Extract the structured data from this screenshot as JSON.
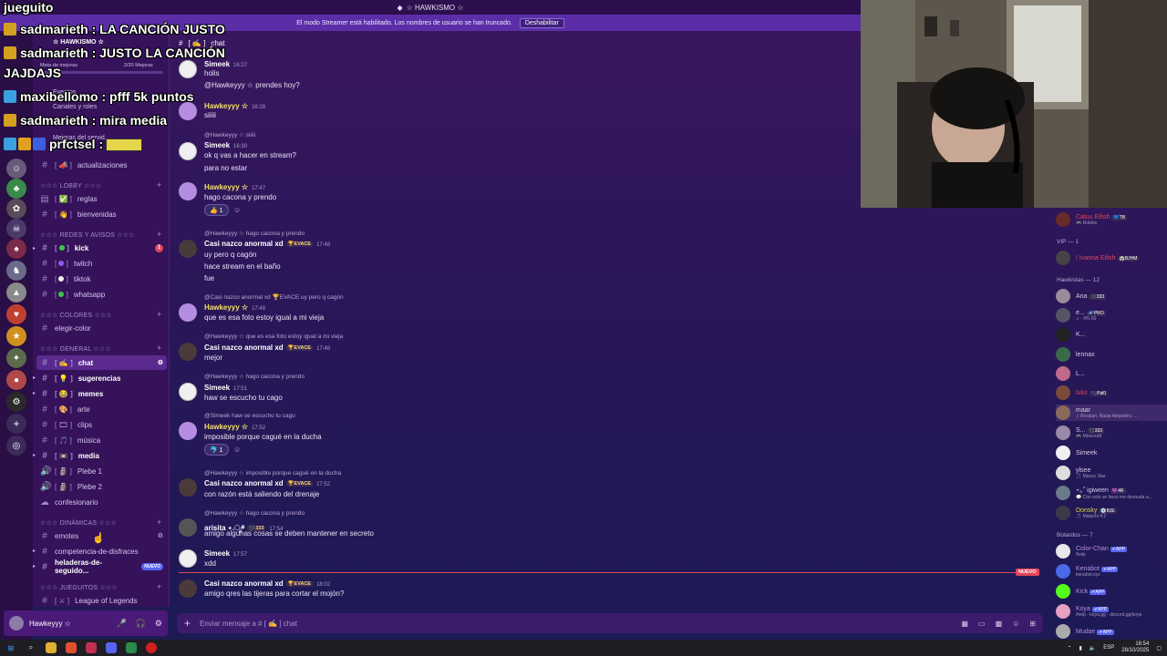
{
  "server": {
    "name": "☆ HAWKISMO ☆",
    "streamer_notice": "El modo Streamer está habilitado. Los nombres de usuario se han truncado.",
    "disable_button": "Deshabilitar",
    "boost_label": "Meta de mejoras",
    "boost_count": "2/20 Mejoras",
    "events": "Eventos",
    "channels_roles": "Canales y roles",
    "server_boosts": "Mejoras del servid..."
  },
  "sidebar": {
    "categories": {
      "lobby": "☆☆☆ LOBBY ☆☆☆",
      "redes": "☆☆☆ REDES Y AVISOS ☆☆☆",
      "colores": "☆☆☆ COLORES ☆☆☆",
      "general": "☆☆☆ GENERAL ☆☆☆",
      "dinamicas": "☆☆☆ DINÁMICAS ☆☆☆",
      "juegos": "☆☆☆ JUEGUITOS ☆☆☆"
    },
    "channels": {
      "actualizaciones": "actualizaciones",
      "reglas": "reglas",
      "bienvenidas": "bienvenidas",
      "kick": "kick",
      "twitch": "twitch",
      "tiktok": "tiktok",
      "whatsapp": "whatsapp",
      "elegir_color": "elegir-color",
      "chat": "chat",
      "sugerencias": "sugerencias",
      "memes": "memes",
      "arte": "arte",
      "clips": "clips",
      "musica": "música",
      "media": "media",
      "plebe1": "Plebe 1",
      "plebe2": "Plebe 2",
      "confesionario": "confesionario",
      "emotes": "emotes",
      "competencia": "competencia-de-disfraces",
      "heladeras": "heladeras-de-seguido...",
      "league": "League of Legends"
    },
    "nuevo_badge": "NUEVO",
    "kick_badge": "1"
  },
  "user_panel": {
    "name": "Hawkeyyy ☆",
    "status": "⋯"
  },
  "chat": {
    "header": "chat",
    "composer_placeholder": "Enviar mensaje a # [ ✍ ] chat",
    "new_label": "NUEVO",
    "messages": [
      {
        "author": "Simeek",
        "time": "16:27",
        "lines": [
          "holis",
          "@Hawkeyyy ☆ prendes hoy?"
        ]
      },
      {
        "author": "Hawkeyyy ☆",
        "time": "16:28",
        "lines": [
          "siiiii"
        ]
      },
      {
        "reply": "@Hawkeyyy ☆ siiiii",
        "author": "Simeek",
        "time": "16:30",
        "lines": [
          "ok q vas a hacer en stream?",
          "para no estar"
        ]
      },
      {
        "author": "Hawkeyyy ☆",
        "time": "17:47",
        "lines": [
          "hago cacona y prendo"
        ],
        "reaction": "👍 1"
      },
      {
        "reply": "@Hawkeyyy ☆ hago cacona y prendo",
        "author": "Casi nazco anormal xd",
        "badge": "🏆EVACE",
        "time": "17:48",
        "lines": [
          "uy pero q cagón",
          "hace stream en el baño",
          "fue"
        ]
      },
      {
        "reply": "@Casi nazco anormal xd 🏆EVACE uy pero q cagón",
        "author": "Hawkeyyy ☆",
        "time": "17:48",
        "lines": [
          "que es esa foto estoy igual a mi vieja"
        ]
      },
      {
        "reply": "@Hawkeyyy ☆ que es esa foto estoy igual a mi vieja",
        "author": "Casi nazco anormal xd",
        "badge": "🏆EVACE",
        "time": "17:48",
        "lines": [
          "mejor"
        ]
      },
      {
        "reply": "@Hawkeyyy ☆ hago cacona y prendo",
        "author": "Simeek",
        "time": "17:51",
        "lines": [
          "haw se escucho tu cago"
        ]
      },
      {
        "reply": "@Simeek haw se escucho tu cago",
        "author": "Hawkeyyy ☆",
        "time": "17:52",
        "lines": [
          "imposible porque cagué en la ducha"
        ],
        "reaction": "🐬 1"
      },
      {
        "reply": "@Hawkeyyy ☆ imposible porque cagué en la ducha",
        "author": "Casi nazco anormal xd",
        "badge": "🏆EVACE",
        "time": "17:52",
        "lines": [
          "con razón está saliendo del drenaje"
        ]
      },
      {
        "reply": "@Hawkeyyy ☆ hago cacona y prendo",
        "author": "arisita ⋆.ೃ࿔",
        "badge": "💱333",
        "time": "17:54",
        "lines": [
          "amigo algunas cosas se deben mantener en secreto"
        ]
      },
      {
        "author": "Simeek",
        "time": "17:57",
        "lines": [
          "xdd"
        ]
      },
      {
        "author": "Casi nazco anormal xd",
        "badge": "🏆EVACE",
        "time": "18:02",
        "lines": [
          "amigo qres las tijeras para cortar el mojón?"
        ]
      }
    ]
  },
  "members": {
    "top": {
      "name": "Catuu Eilish",
      "sub": "🎮 Roblox",
      "badge": "💙TB"
    },
    "vip_header": "VIP — 1",
    "vip": {
      "name": "! Ivanna Eilish",
      "badge": "🐼BJHM"
    },
    "hawkistas_header": "Hawkistas — 12",
    "hawkistas": [
      {
        "name": "Ana",
        "badge": "💱333"
      },
      {
        "name": "e...",
        "badge": "🌌PRO",
        "sub": "♫ · 9% 00"
      },
      {
        "name": "K..."
      },
      {
        "name": "lennax"
      },
      {
        "name": "L..."
      },
      {
        "name": "lulu!",
        "badge": "🐾Pal0"
      },
      {
        "name": "maar",
        "sub": "♫ Rvssian, Rauw Alejandro, ..."
      },
      {
        "name": "S...",
        "badge": "💱333",
        "sub": "🎮 Minecraft"
      },
      {
        "name": "Simeek"
      },
      {
        "name": "ylsee",
        "sub": "🎵 Mazzy Star"
      },
      {
        "name": "⋆｡˚ igiween",
        "badge": "💜4R",
        "sub": "💬 Con solo un beso me desnuda a..."
      },
      {
        "name": "Donsky",
        "badge": "💿BJE",
        "sub": "🎵 Malachi 4:2"
      }
    ],
    "bots_header": "Botardos — 7",
    "bots": [
      {
        "name": "Color-Chan",
        "sub": "/help"
      },
      {
        "name": "Kenabot",
        "sub": "kenabot.xyz"
      },
      {
        "name": "Kick"
      },
      {
        "name": "Koya",
        "sub": "/help - koya.gg - discord.gg/koya"
      },
      {
        "name": "Mudae"
      }
    ],
    "app_badge": "✔APP"
  },
  "overlay": {
    "top": "jueguito",
    "lines": [
      "sadmarieth : LA CANCIÓN JUSTO",
      "sadmarieth : JUSTO LA CANCIÓN",
      "JAJDAJS",
      "maxibellomo : pfff 5k puntos",
      "sadmarieth : mira media",
      "prfctsel :"
    ]
  },
  "taskbar": {
    "lang": "ESP",
    "time": "18:54",
    "date": "28/10/2025"
  },
  "colors": {
    "name_simeek": "#ffffff",
    "name_hawk": "#f2e06a",
    "name_casi": "#ffffff",
    "bot_name": "#b58de0"
  }
}
